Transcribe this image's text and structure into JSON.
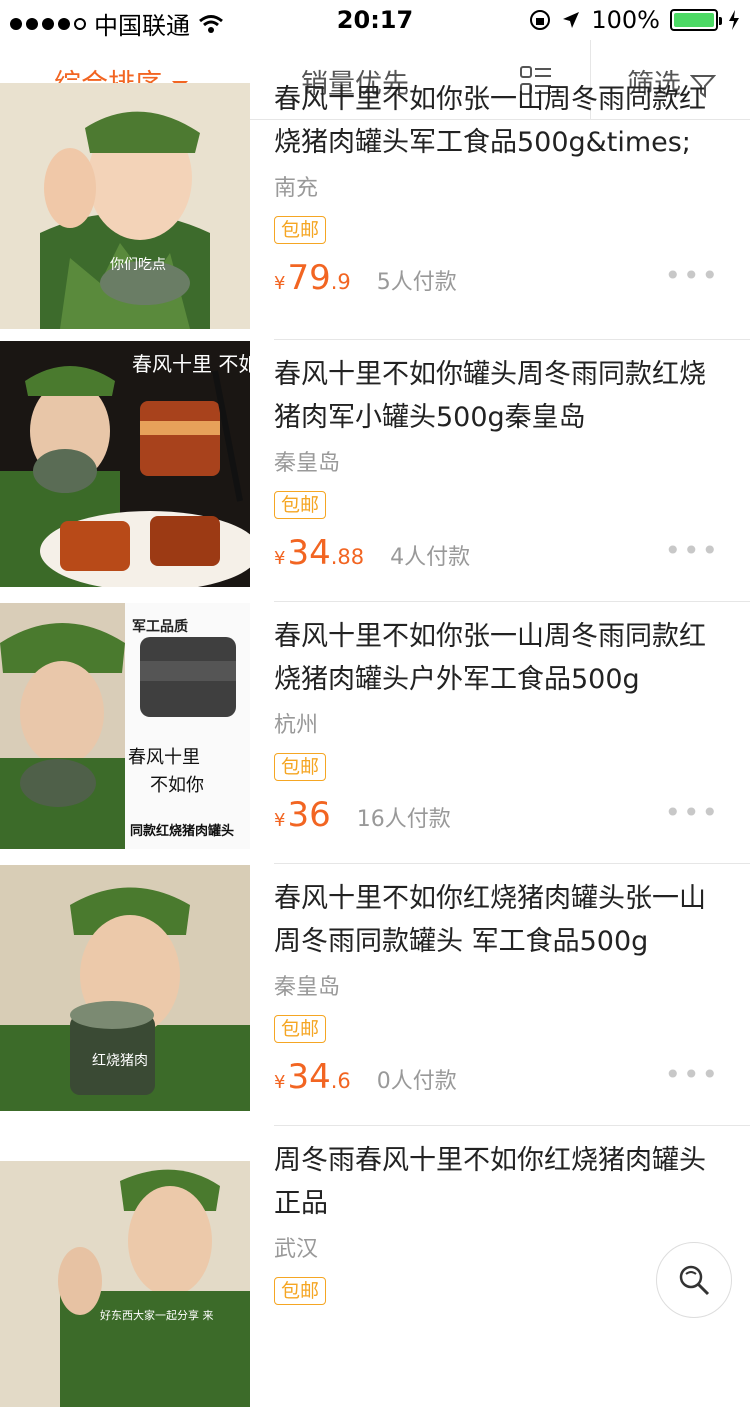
{
  "status_bar": {
    "carrier": "中国联通",
    "time": "20:17",
    "battery": "100%"
  },
  "sort_bar": {
    "active_label": "综合排序",
    "sales_label": "销量优先",
    "filter_label": "筛选"
  },
  "products": [
    {
      "title": "春风十里不如你张一山周冬雨同款红烧猪肉罐头军工食品500g&times;",
      "city": "南充",
      "badge": "包邮",
      "price_int": "79",
      "price_dec": ".9",
      "sold": "5人付款",
      "thumb_text": "你们吃点",
      "currency": "¥"
    },
    {
      "title": "春风十里不如你罐头周冬雨同款红烧猪肉军小罐头500g秦皇岛",
      "city": "秦皇岛",
      "badge": "包邮",
      "price_int": "34",
      "price_dec": ".88",
      "sold": "4人付款",
      "thumb_text": "春风十里 不如你",
      "currency": "¥"
    },
    {
      "title": "春风十里不如你张一山周冬雨同款红烧猪肉罐头户外军工食品500g",
      "city": "杭州",
      "badge": "包邮",
      "price_int": "36",
      "price_dec": "",
      "sold": "16人付款",
      "thumb_text": "军工品质",
      "currency": "¥"
    },
    {
      "title": "春风十里不如你红烧猪肉罐头张一山周冬雨同款罐头 军工食品500g",
      "city": "秦皇岛",
      "badge": "包邮",
      "price_int": "34",
      "price_dec": ".6",
      "sold": "0人付款",
      "thumb_text": "红烧猪肉",
      "currency": "¥"
    },
    {
      "title": "周冬雨春风十里不如你红烧猪肉罐头正品",
      "city": "武汉",
      "badge": "包邮",
      "price_int": "",
      "price_dec": "",
      "sold": "",
      "thumb_text": "好东西大家一起分享 来",
      "currency": ""
    }
  ],
  "colors": {
    "accent": "#f26522",
    "badge": "#f5a623"
  }
}
